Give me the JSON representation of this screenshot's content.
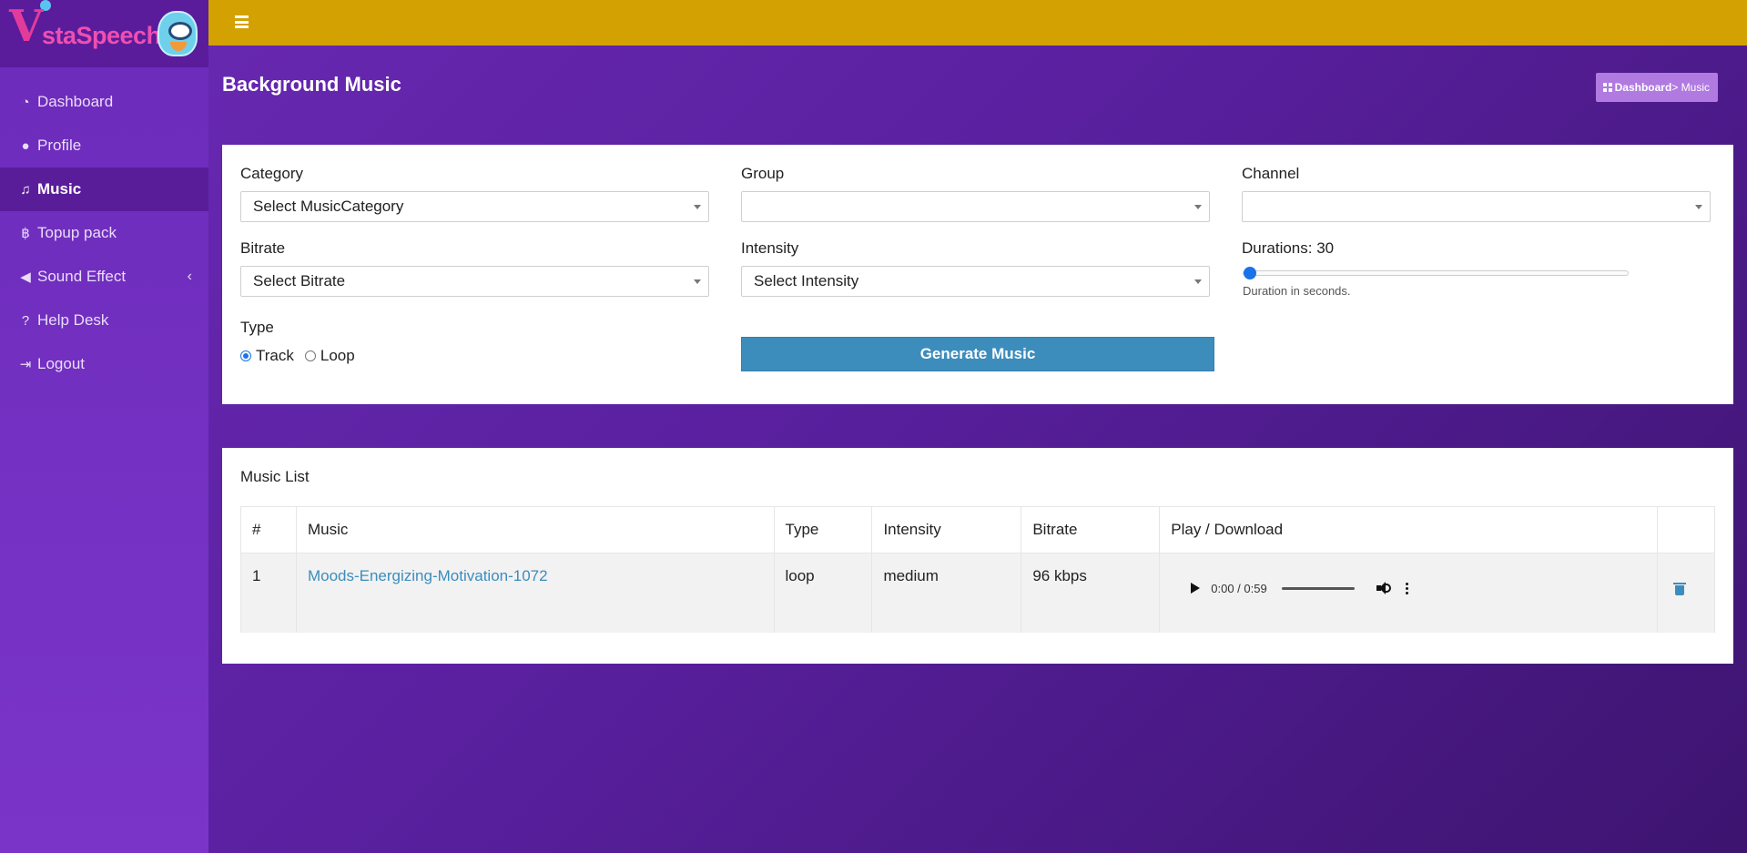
{
  "app": {
    "logo_v": "V",
    "logo_text": "staSpeech"
  },
  "sidebar": {
    "items": [
      {
        "label": "Dashboard",
        "icon": "dashboard-icon"
      },
      {
        "label": "Profile",
        "icon": "user-icon"
      },
      {
        "label": "Music",
        "icon": "music-icon",
        "active": true
      },
      {
        "label": "Topup pack",
        "icon": "bitcoin-icon"
      },
      {
        "label": "Sound Effect",
        "icon": "volume-icon",
        "has_submenu": true
      },
      {
        "label": "Help Desk",
        "icon": "question-icon"
      },
      {
        "label": "Logout",
        "icon": "logout-icon"
      }
    ]
  },
  "colors": {
    "topbar": "#d3a102",
    "sidebar": "#6c2bbb",
    "accent": "#3c8dbc",
    "breadcrumb": "#b07ae0"
  },
  "page": {
    "title": "Background Music",
    "breadcrumb": {
      "home": "Dashboard",
      "current": "> Music"
    }
  },
  "form": {
    "category": {
      "label": "Category",
      "value": "Select MusicCategory"
    },
    "group": {
      "label": "Group",
      "value": ""
    },
    "channel": {
      "label": "Channel",
      "value": ""
    },
    "bitrate": {
      "label": "Bitrate",
      "value": "Select Bitrate"
    },
    "intensity": {
      "label": "Intensity",
      "value": "Select Intensity"
    },
    "duration": {
      "label": "Durations: 30",
      "value": 30,
      "min": 30,
      "max": 600,
      "hint": "Duration in seconds."
    },
    "type": {
      "label": "Type",
      "options": [
        "Track",
        "Loop"
      ],
      "selected": "Track"
    },
    "generate_label": "Generate Music"
  },
  "list": {
    "title": "Music List",
    "columns": [
      "#",
      "Music",
      "Type",
      "Intensity",
      "Bitrate",
      "Play / Download",
      ""
    ],
    "rows": [
      {
        "num": "1",
        "music": "Moods-Energizing-Motivation-1072",
        "type": "loop",
        "intensity": "medium",
        "bitrate": "96 kbps",
        "time": "0:00 / 0:59"
      }
    ]
  }
}
